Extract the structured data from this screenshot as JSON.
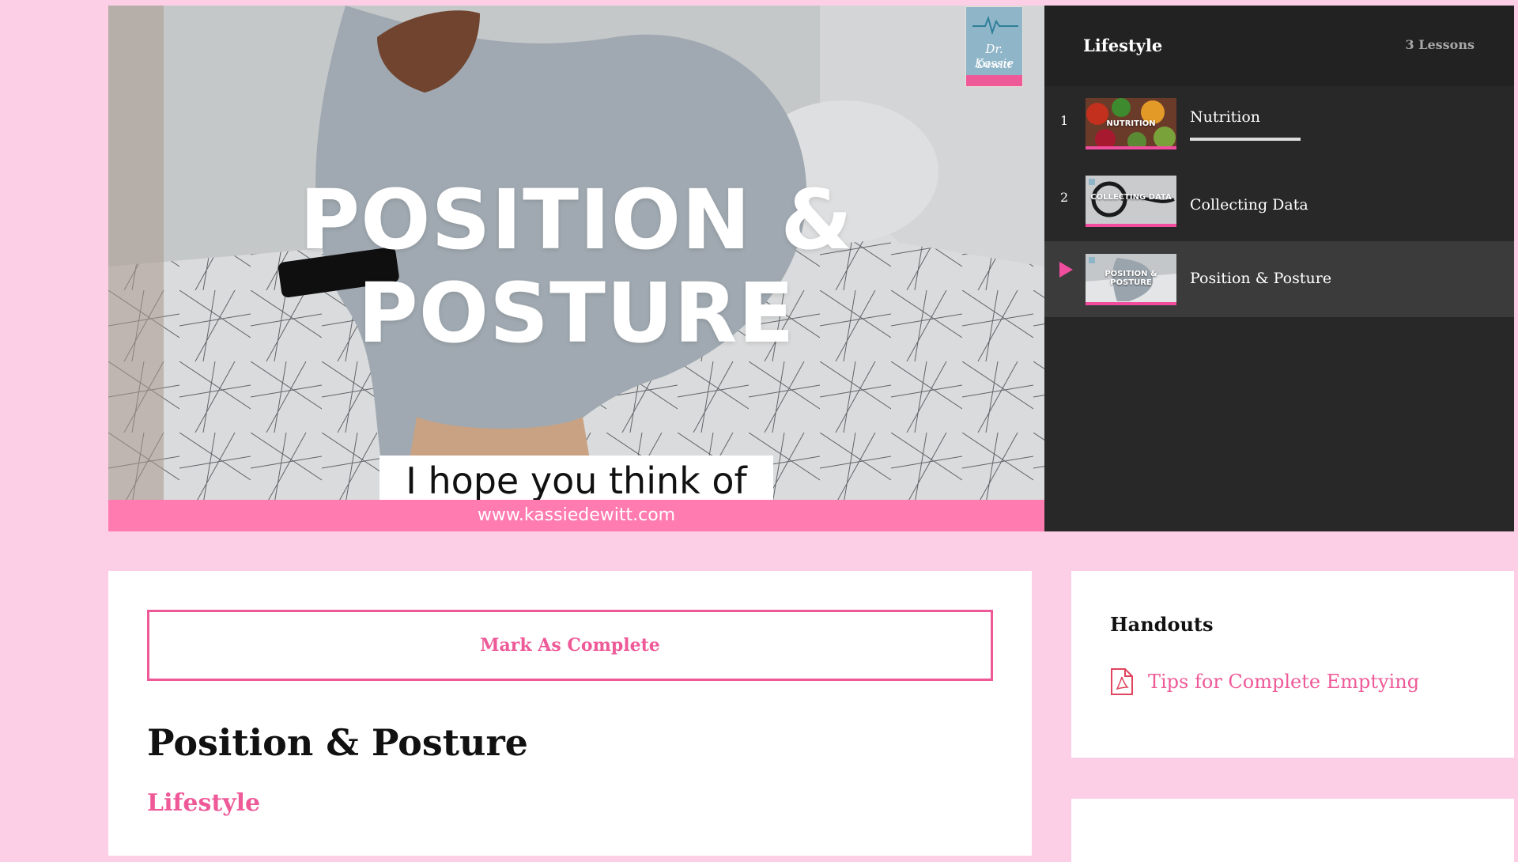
{
  "video": {
    "title_line1": "POSITION &",
    "title_line2": "POSTURE",
    "caption": "I hope you think of me",
    "website": "www.kassiedewitt.com",
    "logo_line1": "Dr. Kassie",
    "logo_line2": "Dewitt",
    "icon": "video-frame"
  },
  "playlist": {
    "title": "Lifestyle",
    "count": "3 Lessons",
    "items": [
      {
        "number": "1",
        "label": "Nutrition",
        "thumb_text": "NUTRITION",
        "watched_fraction": 0.6
      },
      {
        "number": "2",
        "label": "Collecting Data",
        "thumb_text": "COLLECTING DATA"
      },
      {
        "number": "",
        "label": "Position & Posture",
        "thumb_text": "POSITION & POSTURE",
        "active": true,
        "icon": "play-icon"
      }
    ]
  },
  "main": {
    "complete_label": "Mark As Complete",
    "lesson_title": "Position & Posture",
    "category": "Lifestyle"
  },
  "handouts": {
    "title": "Handouts",
    "items": [
      {
        "label": "Tips for Complete Emptying",
        "icon": "pdf-icon"
      }
    ]
  },
  "colors": {
    "accent": "#ee5a98",
    "background": "#fdcfe6",
    "playlist_bg": "#282828"
  }
}
